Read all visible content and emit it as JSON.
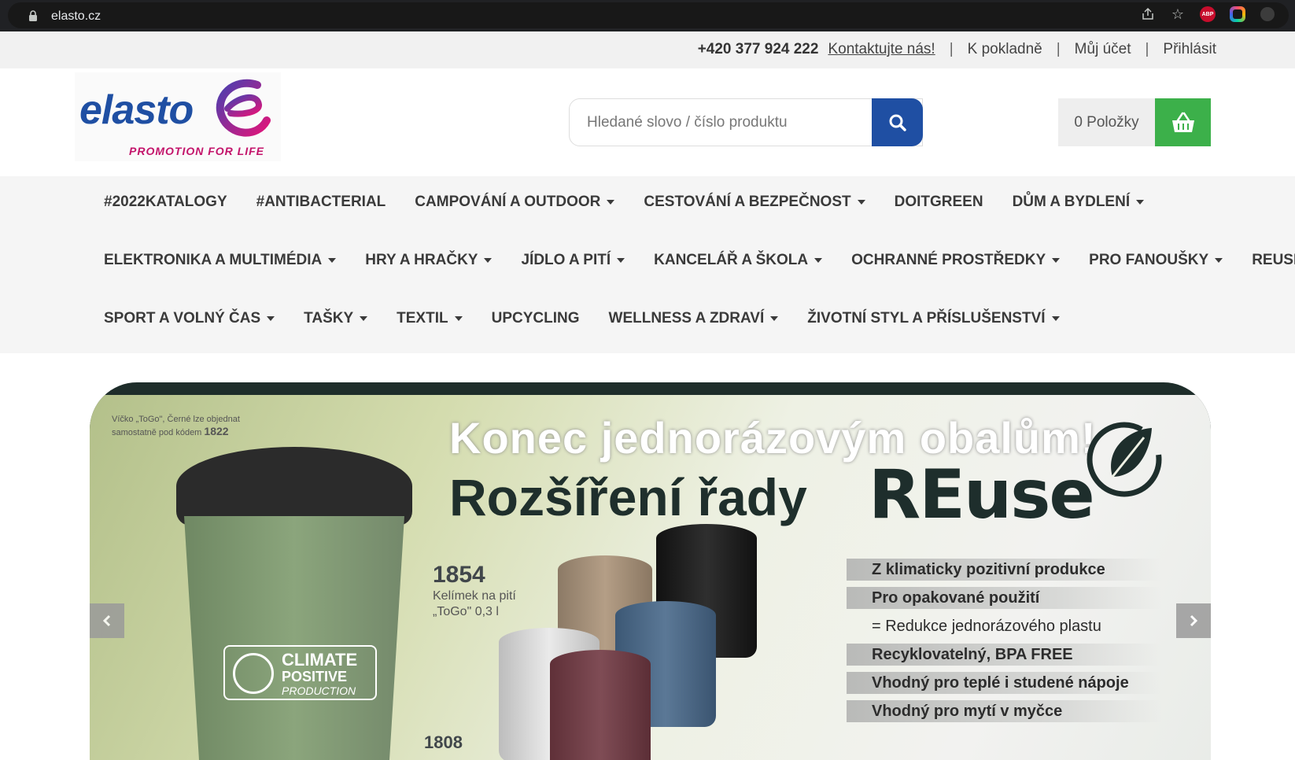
{
  "browser": {
    "url": "elasto.cz"
  },
  "topbar": {
    "phone": "+420 377 924 222",
    "contact": "Kontaktujte nás!",
    "checkout": "K pokladně",
    "account": "Můj účet",
    "login": "Přihlásit"
  },
  "header": {
    "logo_text": "elasto",
    "logo_tagline": "PROMOTION FOR LIFE",
    "search_placeholder": "Hledané slovo / číslo produktu",
    "cart_label": "0 Položky"
  },
  "nav": {
    "row1": [
      {
        "label": "#2022KATALOGY",
        "dropdown": false
      },
      {
        "label": "#ANTIBACTERIAL",
        "dropdown": false
      },
      {
        "label": "CAMPOVÁNÍ A OUTDOOR",
        "dropdown": true
      },
      {
        "label": "CESTOVÁNÍ A BEZPEČNOST",
        "dropdown": true
      },
      {
        "label": "DOITGREEN",
        "dropdown": false
      },
      {
        "label": "DŮM A BYDLENÍ",
        "dropdown": true
      }
    ],
    "row2": [
      {
        "label": "ELEKTRONIKA A MULTIMÉDIA",
        "dropdown": true
      },
      {
        "label": "HRY A HRAČKY",
        "dropdown": true
      },
      {
        "label": "JÍDLO A PITÍ",
        "dropdown": true
      },
      {
        "label": "KANCELÁŘ A ŠKOLA",
        "dropdown": true
      },
      {
        "label": "OCHRANNÉ PROSTŘEDKY",
        "dropdown": true
      },
      {
        "label": "PRO FANOUŠKY",
        "dropdown": true
      },
      {
        "label": "REUSE",
        "dropdown": false
      }
    ],
    "row3": [
      {
        "label": "SPORT A VOLNÝ ČAS",
        "dropdown": true
      },
      {
        "label": "TAŠKY",
        "dropdown": true
      },
      {
        "label": "TEXTIL",
        "dropdown": true
      },
      {
        "label": "UPCYCLING",
        "dropdown": false
      },
      {
        "label": "WELLNESS A ZDRAVÍ",
        "dropdown": true
      },
      {
        "label": "ŽIVOTNÍ STYL A PŘÍSLUŠENSTVÍ",
        "dropdown": true
      }
    ]
  },
  "banner": {
    "headline1": "Konec jednorázovým obalům!",
    "headline2": "Rozšíření řady",
    "brand": "REuse",
    "lid_note_line1": "Víčko „ToGo\", Černé lze objednat",
    "lid_note_line2": "samostatně pod kódem",
    "lid_code": "1822",
    "product1_code": "1854",
    "product1_desc_line1": "Kelímek na pití",
    "product1_desc_line2": "„ToGo\" 0,3 l",
    "product2_code": "1808",
    "badge_line1": "CLIMATE",
    "badge_line2": "POSITIVE",
    "badge_line3": "PRODUCTION",
    "features": [
      "Z klimaticky pozitivní produkce",
      "Pro opakované použití",
      "= Redukce jednorázového plastu",
      "Recyklovatelný, BPA FREE",
      "Vhodný pro teplé i studené nápoje",
      "Vhodný pro mytí v myčce"
    ]
  },
  "colors": {
    "brand_blue": "#1f4fa3",
    "brand_magenta": "#c3136a",
    "cart_green": "#3cb04a"
  }
}
